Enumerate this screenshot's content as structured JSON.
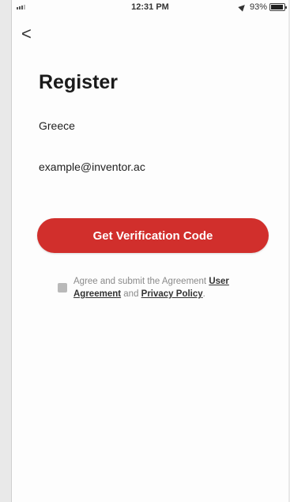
{
  "status_bar": {
    "time": "12:31 PM",
    "battery_percent": "93%",
    "battery_level": 0.93
  },
  "icons": {
    "back": "chevron-left-icon",
    "location": "location-arrow-icon",
    "battery": "battery-icon",
    "signal": "signal-icon"
  },
  "header": {
    "back_glyph": "<",
    "title": "Register"
  },
  "form": {
    "country_value": "Greece",
    "email_value": "example@inventor.ac",
    "submit_label": "Get Verification Code"
  },
  "agreement": {
    "prefix": "Agree and submit the Agreement ",
    "user_agreement_link": "User Agreement",
    "conjunction": " and ",
    "privacy_link": "Privacy Policy",
    "suffix": "."
  },
  "colors": {
    "accent": "#d12f2c",
    "background": "#fdfdfd"
  }
}
